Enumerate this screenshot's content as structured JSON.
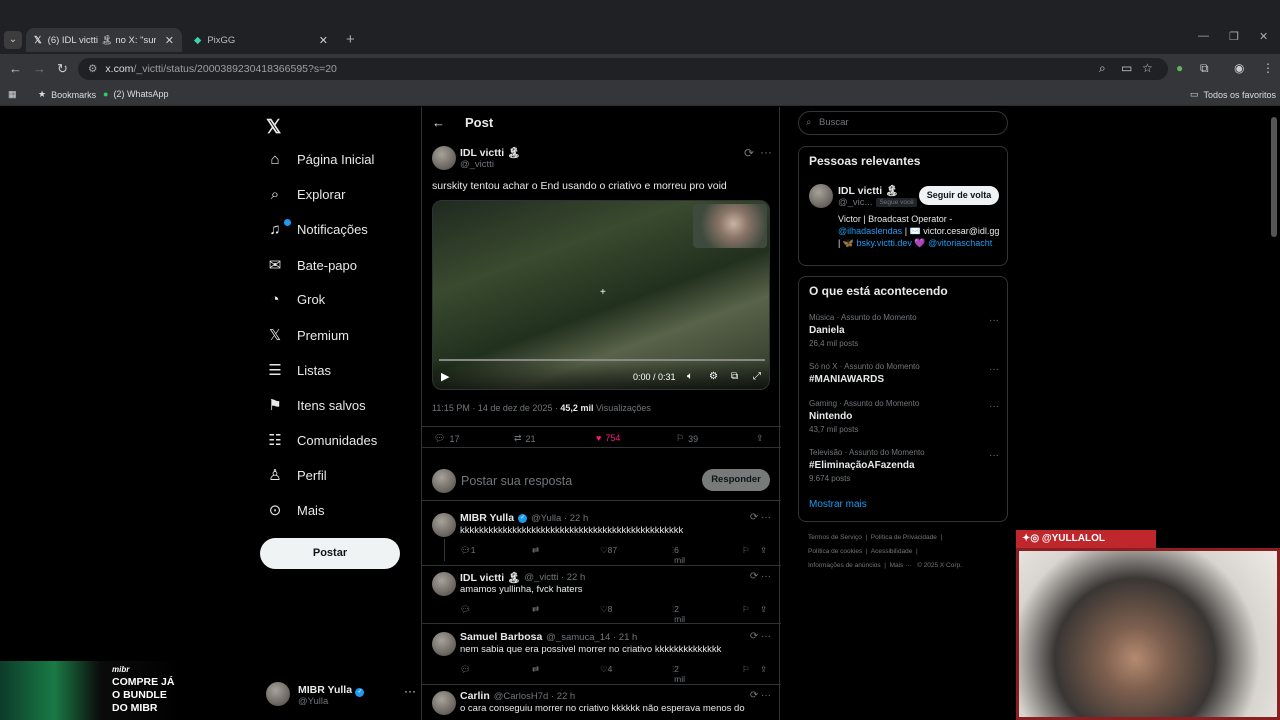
{
  "browser": {
    "tabs": [
      {
        "title": "(6) IDL victti 🏝 no X: \"surskity",
        "active": true
      },
      {
        "title": "PixGG",
        "active": false
      }
    ],
    "url": "x.com/_victti/status/2000389230418366595?s=20",
    "url_host": "x.com",
    "url_path": "/_victti/status/2000389230418366595?s=20",
    "bookmarks": [
      {
        "label": "Bookmarks"
      },
      {
        "label": "(2) WhatsApp"
      }
    ],
    "other_bookmarks": "Todos os favoritos"
  },
  "nav": {
    "items": [
      {
        "label": "Página Inicial",
        "icon": "home-icon"
      },
      {
        "label": "Explorar",
        "icon": "search-icon"
      },
      {
        "label": "Notificações",
        "icon": "bell-icon"
      },
      {
        "label": "Bate-papo",
        "icon": "mail-icon"
      },
      {
        "label": "Grok",
        "icon": "grok-icon"
      },
      {
        "label": "Premium",
        "icon": "x-icon"
      },
      {
        "label": "Listas",
        "icon": "list-icon"
      },
      {
        "label": "Itens salvos",
        "icon": "bookmark-icon"
      },
      {
        "label": "Comunidades",
        "icon": "people-icon"
      },
      {
        "label": "Perfil",
        "icon": "person-icon"
      },
      {
        "label": "Mais",
        "icon": "more-icon"
      }
    ],
    "post_button": "Postar",
    "account_name": "MIBR Yulla",
    "account_handle": "@Yulla"
  },
  "post": {
    "header": "Post",
    "author_name": "IDL victti 🏝",
    "author_handle": "@_victti",
    "text": "surskity tentou achar o End usando o criativo e morreu pro void",
    "video_time": "0:00 / 0:31",
    "timestamp": "11:15 PM · 14 de dez de 2025",
    "views_count": "45,2 mil",
    "views_label": "Visualizações",
    "replies": "17",
    "reposts": "21",
    "likes": "754",
    "bookmarks": "39",
    "reply_placeholder": "Postar sua resposta",
    "reply_button": "Responder"
  },
  "replies": [
    {
      "name": "MIBR Yulla",
      "handle": "@Yulla · 22 h",
      "text": "kkkkkkkkkkkkkkkkkkkkkkkkkkkkkkkkkkkkkkkkkkkkkkk",
      "replies": "1",
      "reposts": "",
      "likes": "87",
      "views": "6 mil",
      "verified": true
    },
    {
      "name": "IDL victti 🏝",
      "handle": "@_victti · 22 h",
      "text": "amamos yullinha, fvck haters",
      "replies": "",
      "reposts": "",
      "likes": "8",
      "views": "2 mil",
      "verified": false
    },
    {
      "name": "Samuel Barbosa",
      "handle": "@_samuca_14 · 21 h",
      "text": "nem sabia que era possivel morrer no criativo kkkkkkkkkkkkkk",
      "replies": "",
      "reposts": "",
      "likes": "4",
      "views": "2 mil",
      "verified": false
    },
    {
      "name": "Carlin",
      "handle": "@CarlosH7d · 22 h",
      "text": "o cara conseguiu morrer no criativo kkkkkk não esperava menos do",
      "replies": "",
      "reposts": "",
      "likes": "",
      "views": "",
      "verified": false
    }
  ],
  "sidebar": {
    "search_placeholder": "Buscar",
    "relevant_title": "Pessoas relevantes",
    "person_name": "IDL victti 🏝",
    "person_handle": "@_vic...",
    "follows_you": "Segue você",
    "follow_back": "Seguir de volta",
    "bio_1": "Victor | Broadcast Operator -",
    "bio_link_1": "@ilhadaslendas",
    "bio_2": " | ✉️",
    "bio_3": "victor.cesar@idl.gg | 🦋 ",
    "bio_link_2": "bsky.victti.dev",
    "bio_4": "💜 ",
    "bio_link_3": "@vitoriaschacht",
    "trending_title": "O que está acontecendo",
    "trends": [
      {
        "category": "Música · Assunto do Momento",
        "name": "Daniela",
        "count": "26,4 mil posts"
      },
      {
        "category": "Só no X · Assunto do Momento",
        "name": "#MANIAWARDS",
        "count": ""
      },
      {
        "category": "Gaming · Assunto do Momento",
        "name": "Nintendo",
        "count": "43,7 mil posts"
      },
      {
        "category": "Televisão · Assunto do Momento",
        "name": "#EliminaçãoAFazenda",
        "count": "9.674 posts"
      }
    ],
    "show_more": "Mostrar mais",
    "footer": [
      "Termos de Serviço",
      "Política de Privacidade",
      "Política de cookies",
      "Acessibilidade",
      "Informações de anúncios",
      "Mais ···",
      "© 2025 X Corp."
    ]
  },
  "overlays": {
    "cam_label": "@YULLALOL",
    "promo_brand": "mibr",
    "promo_line1": "COMPRE JÁ",
    "promo_line2": "O BUNDLE",
    "promo_line3": "DO MIBR"
  },
  "colors": {
    "accent": "#1d9bf0",
    "like": "#f91880",
    "bg": "#000000"
  }
}
